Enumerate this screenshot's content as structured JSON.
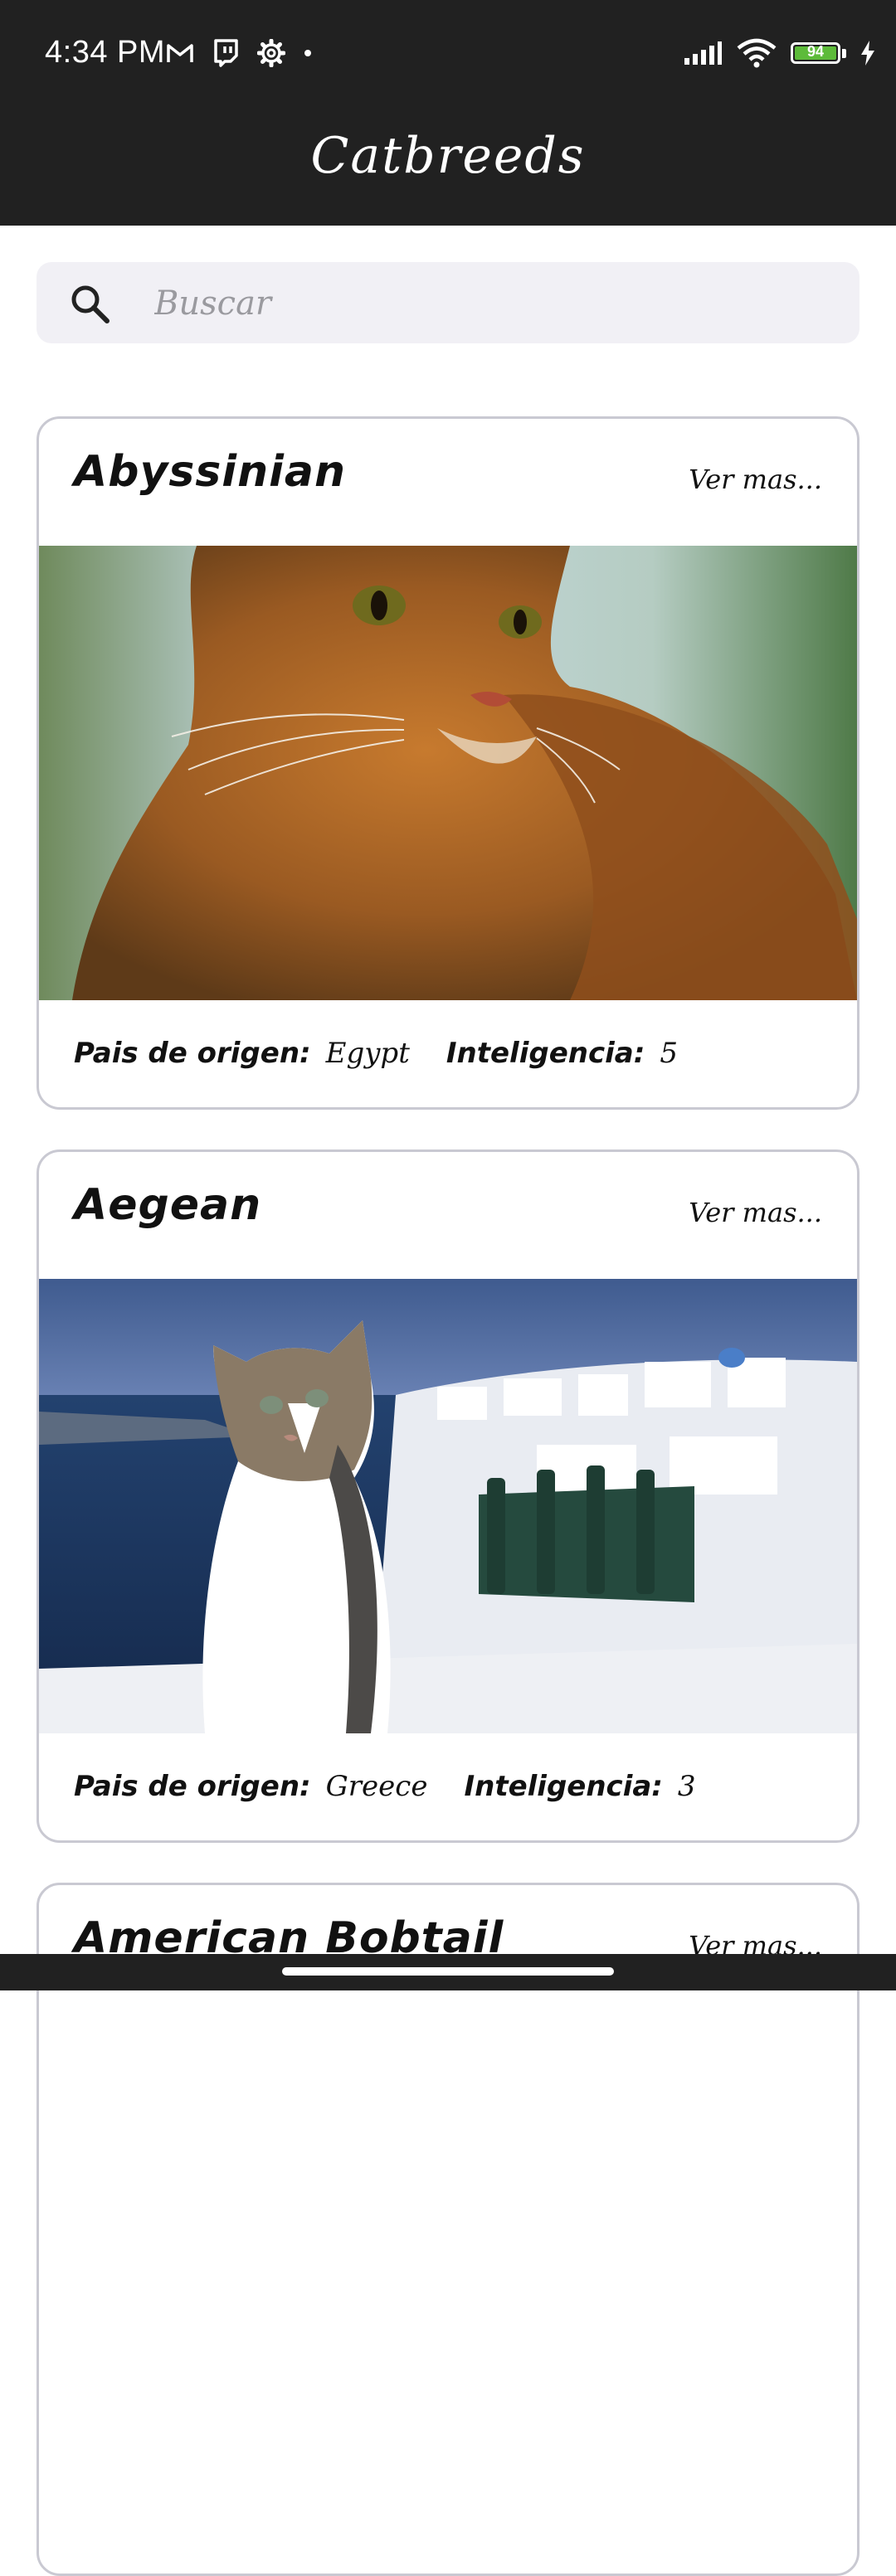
{
  "status": {
    "time": "4:34 PM",
    "battery_level": "94",
    "icons_left": [
      "gmail-icon",
      "twitch-icon",
      "settings-gear-icon",
      "dot-icon"
    ],
    "icons_right": [
      "signal-icon",
      "wifi-icon",
      "battery-icon",
      "charging-bolt-icon"
    ]
  },
  "app": {
    "title": "Catbreeds"
  },
  "search": {
    "placeholder": "Buscar"
  },
  "breeds": [
    {
      "name": "Abyssinian",
      "more": "Ver mas...",
      "origin_label": "Pais de origen:",
      "origin": "Egypt",
      "intel_label": "Inteligencia:",
      "intelligence": "5"
    },
    {
      "name": "Aegean",
      "more": "Ver mas...",
      "origin_label": "Pais de origen:",
      "origin": "Greece",
      "intel_label": "Inteligencia:",
      "intelligence": "3"
    },
    {
      "name": "American Bobtail",
      "more": "Ver mas..."
    }
  ],
  "colors": {
    "bar_background": "#212121",
    "search_background": "#f1f0f5",
    "card_border": "#c9c9d2",
    "battery_green": "#5dbb3a"
  }
}
